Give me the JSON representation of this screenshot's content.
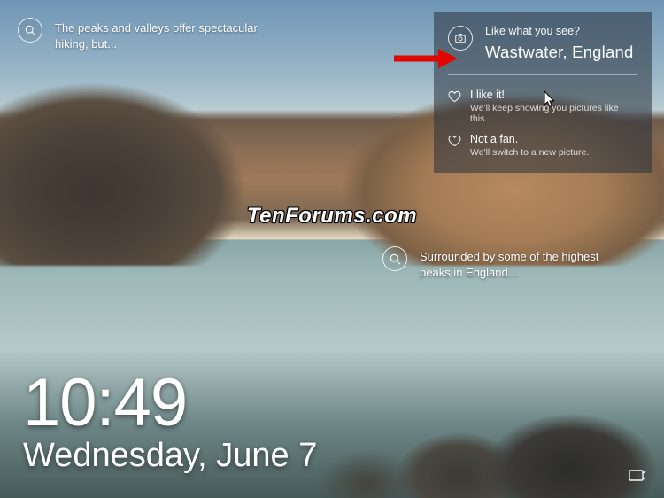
{
  "tips": {
    "topLeft": "The peaks and valleys offer spectacular hiking, but...",
    "mid": "Surrounded by some of the highest peaks in England..."
  },
  "card": {
    "question": "Like what you see?",
    "location": "Wastwater, England",
    "like": {
      "title": "I like it!",
      "sub": "We'll keep showing you pictures like this."
    },
    "dislike": {
      "title": "Not a fan.",
      "sub": "We'll switch to a new picture."
    }
  },
  "clock": {
    "time": "10:49",
    "date": "Wednesday, June 7"
  },
  "watermark": "TenForums.com"
}
